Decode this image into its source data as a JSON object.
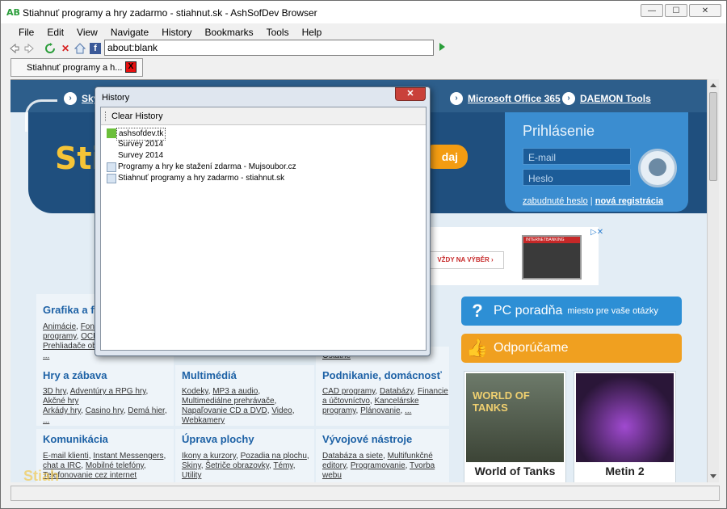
{
  "window": {
    "title": "Stiahnuť programy a hry zadarmo - stiahnut.sk - AshSofDev Browser",
    "app_icon": "AB",
    "minimize": "—",
    "maximize": "☐",
    "close": "✕"
  },
  "menu": [
    "File",
    "Edit",
    "View",
    "Navigate",
    "History",
    "Bookmarks",
    "Tools",
    "Help"
  ],
  "toolbar": {
    "url": "about:blank",
    "icons": [
      "back-icon",
      "forward-icon",
      "refresh-icon",
      "stop-icon",
      "home-icon",
      "facebook-icon"
    ]
  },
  "tab": {
    "label": "Stiahnuť programy a h...",
    "close": "X"
  },
  "page": {
    "top_links": [
      "Sky",
      "Microsoft Office 365",
      "DAEMON Tools"
    ],
    "logo": "Stia",
    "search_button": "daj",
    "login": {
      "title": "Prihlásenie",
      "email_placeholder": "E-mail",
      "password_placeholder": "Heslo",
      "forgot": "zabudnuté heslo",
      "separator": "|",
      "register": "nová registrácia"
    },
    "ad": {
      "button": "VŽDY NA VÝBĚR  ›",
      "corner": "▷✕",
      "banner_label": "INTERNETBANKING"
    },
    "categories": [
      {
        "title": "Grafika a fo",
        "links": [
          "Animácie",
          "Font",
          "programy",
          "OCR",
          "Prehliadače ob",
          "..."
        ]
      },
      {
        "title": "Hry a zábava",
        "links": [
          "3D hry",
          "Adventúry a RPG hry",
          "Akčné hry",
          "Arkády hry",
          "Casino hry",
          "Demá hier",
          "..."
        ]
      },
      {
        "title": "Multimédiá",
        "links": [
          "Kodeky",
          "MP3 a audio",
          "Multimediálne prehrávače",
          "Napaľovanie CD a DVD",
          "Video",
          "Webkamery"
        ]
      },
      {
        "title": "Podnikanie, domácnosť",
        "links": [
          "CAD programy",
          "Databázy",
          "Financie a účtovníctvo",
          "Kancelárske programy",
          "Plánovanie",
          "..."
        ]
      },
      {
        "title": "Komunikácia",
        "links": [
          "E-mail klienti",
          "Instant Messengers",
          "chat a IRC",
          "Mobilné telefóny",
          "Telefonovanie cez internet"
        ]
      },
      {
        "title": "Úprava plochy",
        "links": [
          "Ikony a kurzory",
          "Pozadia na plochu",
          "Skiny",
          "Šetriče obrazovky",
          "Témy",
          "Utility"
        ]
      },
      {
        "title": "Vývojové nástroje",
        "links": [
          "Databáza a siete",
          "Multifunkčné editory",
          "Programovanie",
          "Tvorba webu"
        ]
      }
    ],
    "partial_text": "Ostatné",
    "side_buttons": [
      {
        "icon": "?",
        "label": "PC poradňa",
        "sub": "miesto pre vaše otázky",
        "color": "#2d8fd5"
      },
      {
        "icon": "👍",
        "label": "Odporúčame",
        "sub": "",
        "color": "#f0a020"
      }
    ],
    "games": [
      "World of Tanks",
      "Metin 2"
    ],
    "game_art_text": "WORLD OF TANKS",
    "watermark": "Stiah"
  },
  "history_popup": {
    "title": "History",
    "close": "✕",
    "clear_button": "Clear History",
    "items": [
      {
        "label": "ashsofdev.tk",
        "icon": "site",
        "selected": true
      },
      {
        "label": "Survey 2014",
        "icon": "none",
        "selected": false
      },
      {
        "label": "Survey 2014",
        "icon": "none",
        "selected": false
      },
      {
        "label": "Programy a hry ke stažení zdarma - Mujsoubor.cz",
        "icon": "page",
        "selected": false
      },
      {
        "label": "Stiahnuť programy a hry zadarmo - stiahnut.sk",
        "icon": "page",
        "selected": false
      }
    ]
  }
}
